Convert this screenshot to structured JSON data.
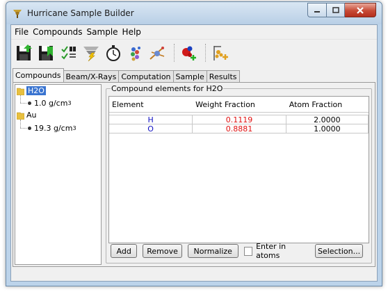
{
  "window": {
    "title": "Hurricane Sample Builder"
  },
  "menu": [
    "File",
    "Compounds",
    "Sample",
    "Help"
  ],
  "toolbar": {
    "icons": [
      "save-compound-icon",
      "save-sample-icon",
      "validate-icon",
      "compute-icon",
      "timer-icon",
      "elements-icon",
      "beam-icon",
      "add-compound-icon",
      "add-layer-icon"
    ]
  },
  "tabs": [
    "Compounds",
    "Beam/X-Rays",
    "Computation",
    "Sample",
    "Results"
  ],
  "tree": {
    "items": [
      {
        "name": "H2O",
        "density_value": "1.0 g/cm",
        "density_exp": "3"
      },
      {
        "name": "Au",
        "density_value": "19.3 g/cm",
        "density_exp": "3"
      }
    ]
  },
  "group": {
    "label": "Compound elements for H2O"
  },
  "table": {
    "headers": [
      "Element",
      "Weight Fraction",
      "Atom Fraction"
    ],
    "rows": [
      {
        "element": "H",
        "weight": "0.1119",
        "atom": "2.0000"
      },
      {
        "element": "O",
        "weight": "0.8881",
        "atom": "1.0000"
      }
    ]
  },
  "buttons": {
    "add": "Add",
    "remove": "Remove",
    "normalize": "Normalize",
    "enter_atoms": "Enter in atoms",
    "selection": "Selection..."
  },
  "colors": {
    "element_text": "#1010c0",
    "weight_text": "#e01010",
    "selection": "#3a74d0"
  }
}
